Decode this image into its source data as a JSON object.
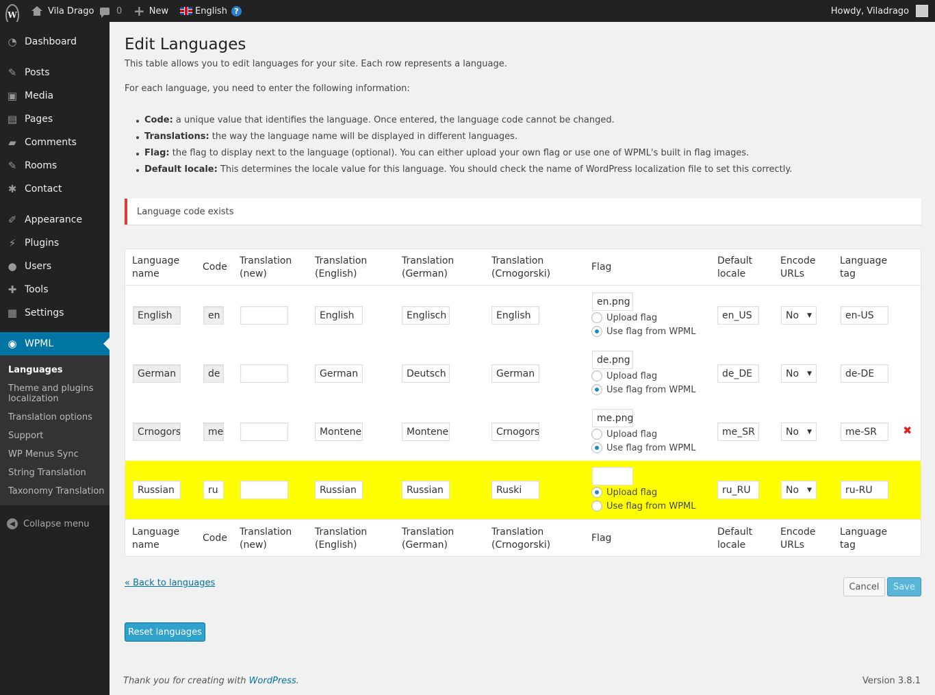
{
  "adminbar": {
    "site_name": "Vila Drago",
    "comments_count": "0",
    "new_label": "New",
    "language": "English",
    "howdy": "Howdy, Viladrago"
  },
  "sidebar": {
    "items": [
      {
        "label": "Dashboard",
        "icon": "dashboard-icon"
      },
      {
        "label": "Posts",
        "icon": "pin-icon"
      },
      {
        "label": "Media",
        "icon": "media-icon"
      },
      {
        "label": "Pages",
        "icon": "pages-icon"
      },
      {
        "label": "Comments",
        "icon": "comment-icon"
      },
      {
        "label": "Rooms",
        "icon": "pin-icon"
      },
      {
        "label": "Contact",
        "icon": "gear-icon"
      },
      {
        "label": "Appearance",
        "icon": "brush-icon"
      },
      {
        "label": "Plugins",
        "icon": "plug-icon"
      },
      {
        "label": "Users",
        "icon": "user-icon"
      },
      {
        "label": "Tools",
        "icon": "wrench-icon"
      },
      {
        "label": "Settings",
        "icon": "settings-icon"
      },
      {
        "label": "WPML",
        "icon": "wpml-icon"
      }
    ],
    "submenu": [
      "Languages",
      "Theme and plugins localization",
      "Translation options",
      "Support",
      "WP Menus Sync",
      "String Translation",
      "Taxonomy Translation"
    ],
    "collapse": "Collapse menu"
  },
  "page": {
    "title": "Edit Languages",
    "intro": "This table allows you to edit languages for your site. Each row represents a language.",
    "intro2": "For each language, you need to enter the following information:",
    "bullets": [
      {
        "term": "Code:",
        "text": " a unique value that identifies the language. Once entered, the language code cannot be changed."
      },
      {
        "term": "Translations:",
        "text": " the way the language name will be displayed in different languages."
      },
      {
        "term": "Flag:",
        "text": " the flag to display next to the language (optional). You can either upload your own flag or use one of WPML's built in flag images."
      },
      {
        "term": "Default locale:",
        "text": " This determines the locale value for this language. You should check the name of WordPress localization file to set this correctly."
      }
    ],
    "notice": "Language code exists"
  },
  "table": {
    "headers": [
      "Language\nname",
      "Code",
      "Translation\n(new)",
      "Translation\n(English)",
      "Translation\n(German)",
      "Translation\n(Crnogorski)",
      "Flag",
      "Default\nlocale",
      "Encode\nURLs",
      "Language\ntag"
    ],
    "upload_flag_label": "Upload flag",
    "use_flag_label": "Use flag from WPML",
    "rows": [
      {
        "name": "English",
        "code": "en",
        "t_new": "",
        "t_en": "English",
        "t_de": "Englisch",
        "t_me": "English",
        "flag": "en.png",
        "flag_mode": "wpml",
        "locale": "en_US",
        "encode": "No",
        "tag": "en-US"
      },
      {
        "name": "German",
        "code": "de",
        "t_new": "",
        "t_en": "German",
        "t_de": "Deutsch",
        "t_me": "German",
        "flag": "de.png",
        "flag_mode": "wpml",
        "locale": "de_DE",
        "encode": "No",
        "tag": "de-DE"
      },
      {
        "name": "Crnogorski",
        "code": "me",
        "t_new": "",
        "t_en": "Montenegrin",
        "t_de": "Montenegrinisch",
        "t_me": "Crnogorski",
        "flag": "me.png",
        "flag_mode": "wpml",
        "locale": "me_SR",
        "encode": "No",
        "tag": "me-SR"
      },
      {
        "name": "Russian",
        "code": "ru",
        "t_new": "",
        "t_en": "Russian",
        "t_de": "Russian",
        "t_me": "Ruski",
        "flag": "",
        "flag_mode": "upload",
        "locale": "ru_RU",
        "encode": "No",
        "tag": "ru-RU"
      }
    ],
    "delete_icon": "delete-icon",
    "highlight_color": "#ffff00"
  },
  "actions": {
    "back": "« Back to languages",
    "cancel": "Cancel",
    "save": "Save",
    "reset": "Reset languages"
  },
  "footer": {
    "thanks": "Thank you for creating with ",
    "wordpress": "WordPress",
    "thanks_end": ".",
    "version": "Version 3.8.1"
  },
  "colors": {
    "accent": "#0074a2",
    "primary_button": "#2ea2cc",
    "error": "#dd3d36"
  }
}
